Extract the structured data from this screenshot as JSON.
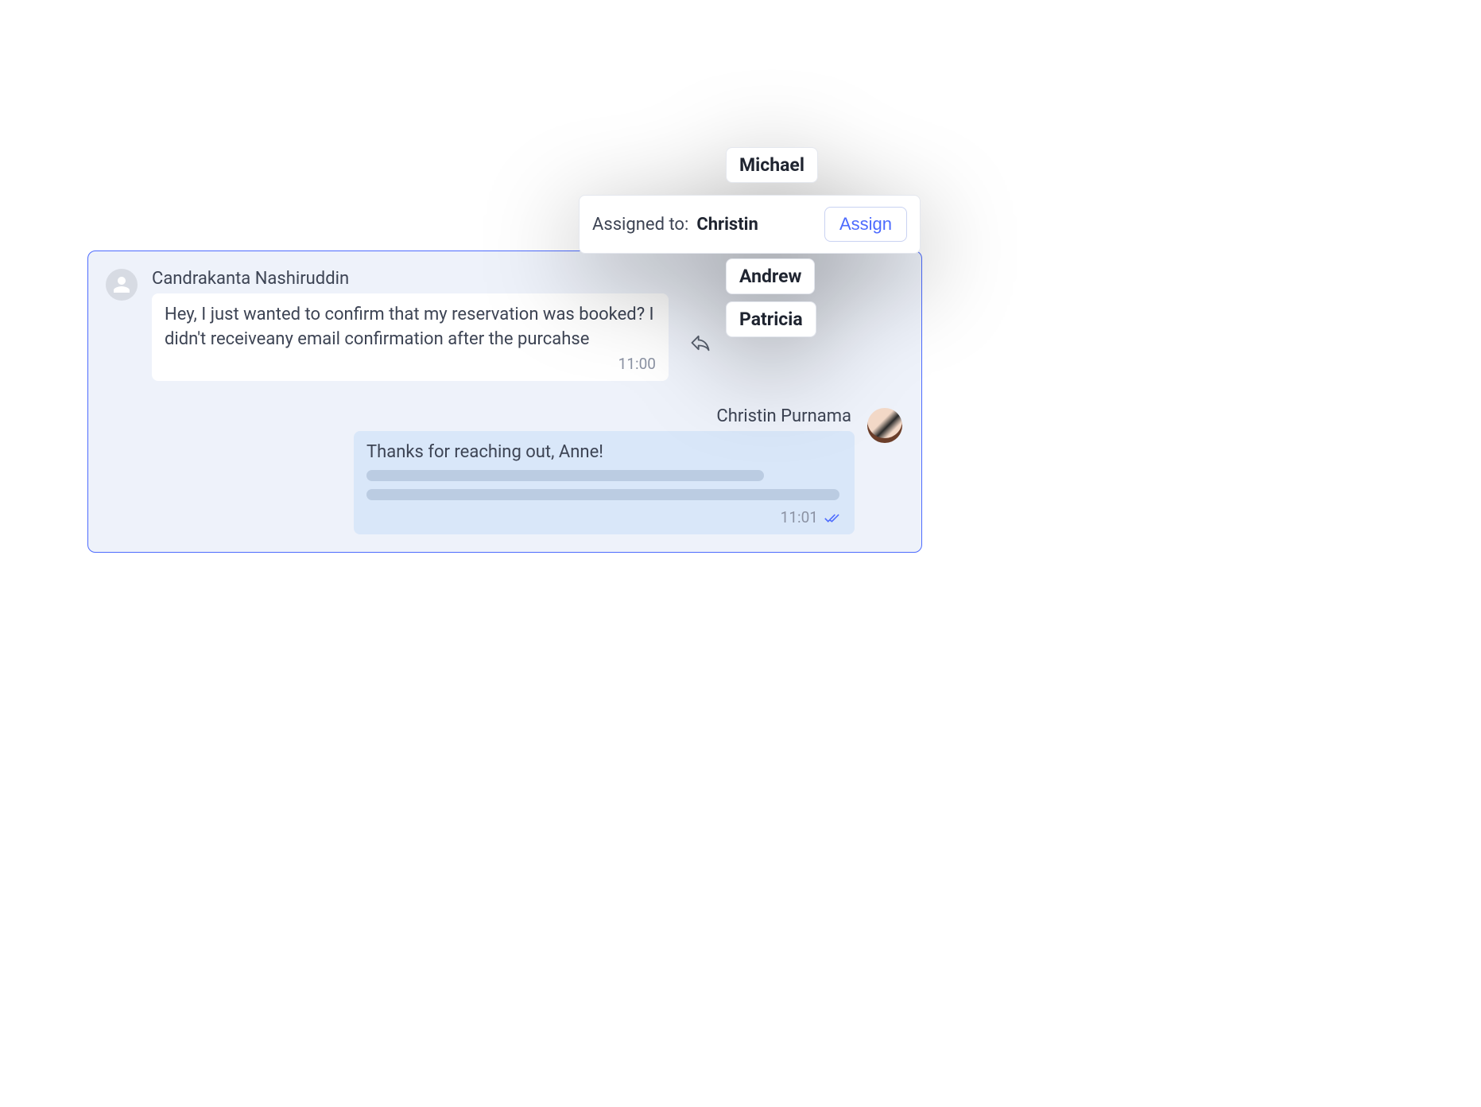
{
  "assign": {
    "options": [
      "Michael",
      "Christin",
      "Andrew",
      "Patricia"
    ],
    "label": "Assigned to:",
    "current": "Christin",
    "button": "Assign"
  },
  "conversation": {
    "incoming": {
      "sender": "Candrakanta Nashiruddin",
      "text": "Hey, I just wanted to confirm that my reservation was booked? I didn't receiveany email confirmation after the purcahse",
      "time": "11:00"
    },
    "outgoing": {
      "sender": "Christin Purnama",
      "text": "Thanks for reaching out, Anne!",
      "time": "11:01",
      "status": "read"
    }
  }
}
